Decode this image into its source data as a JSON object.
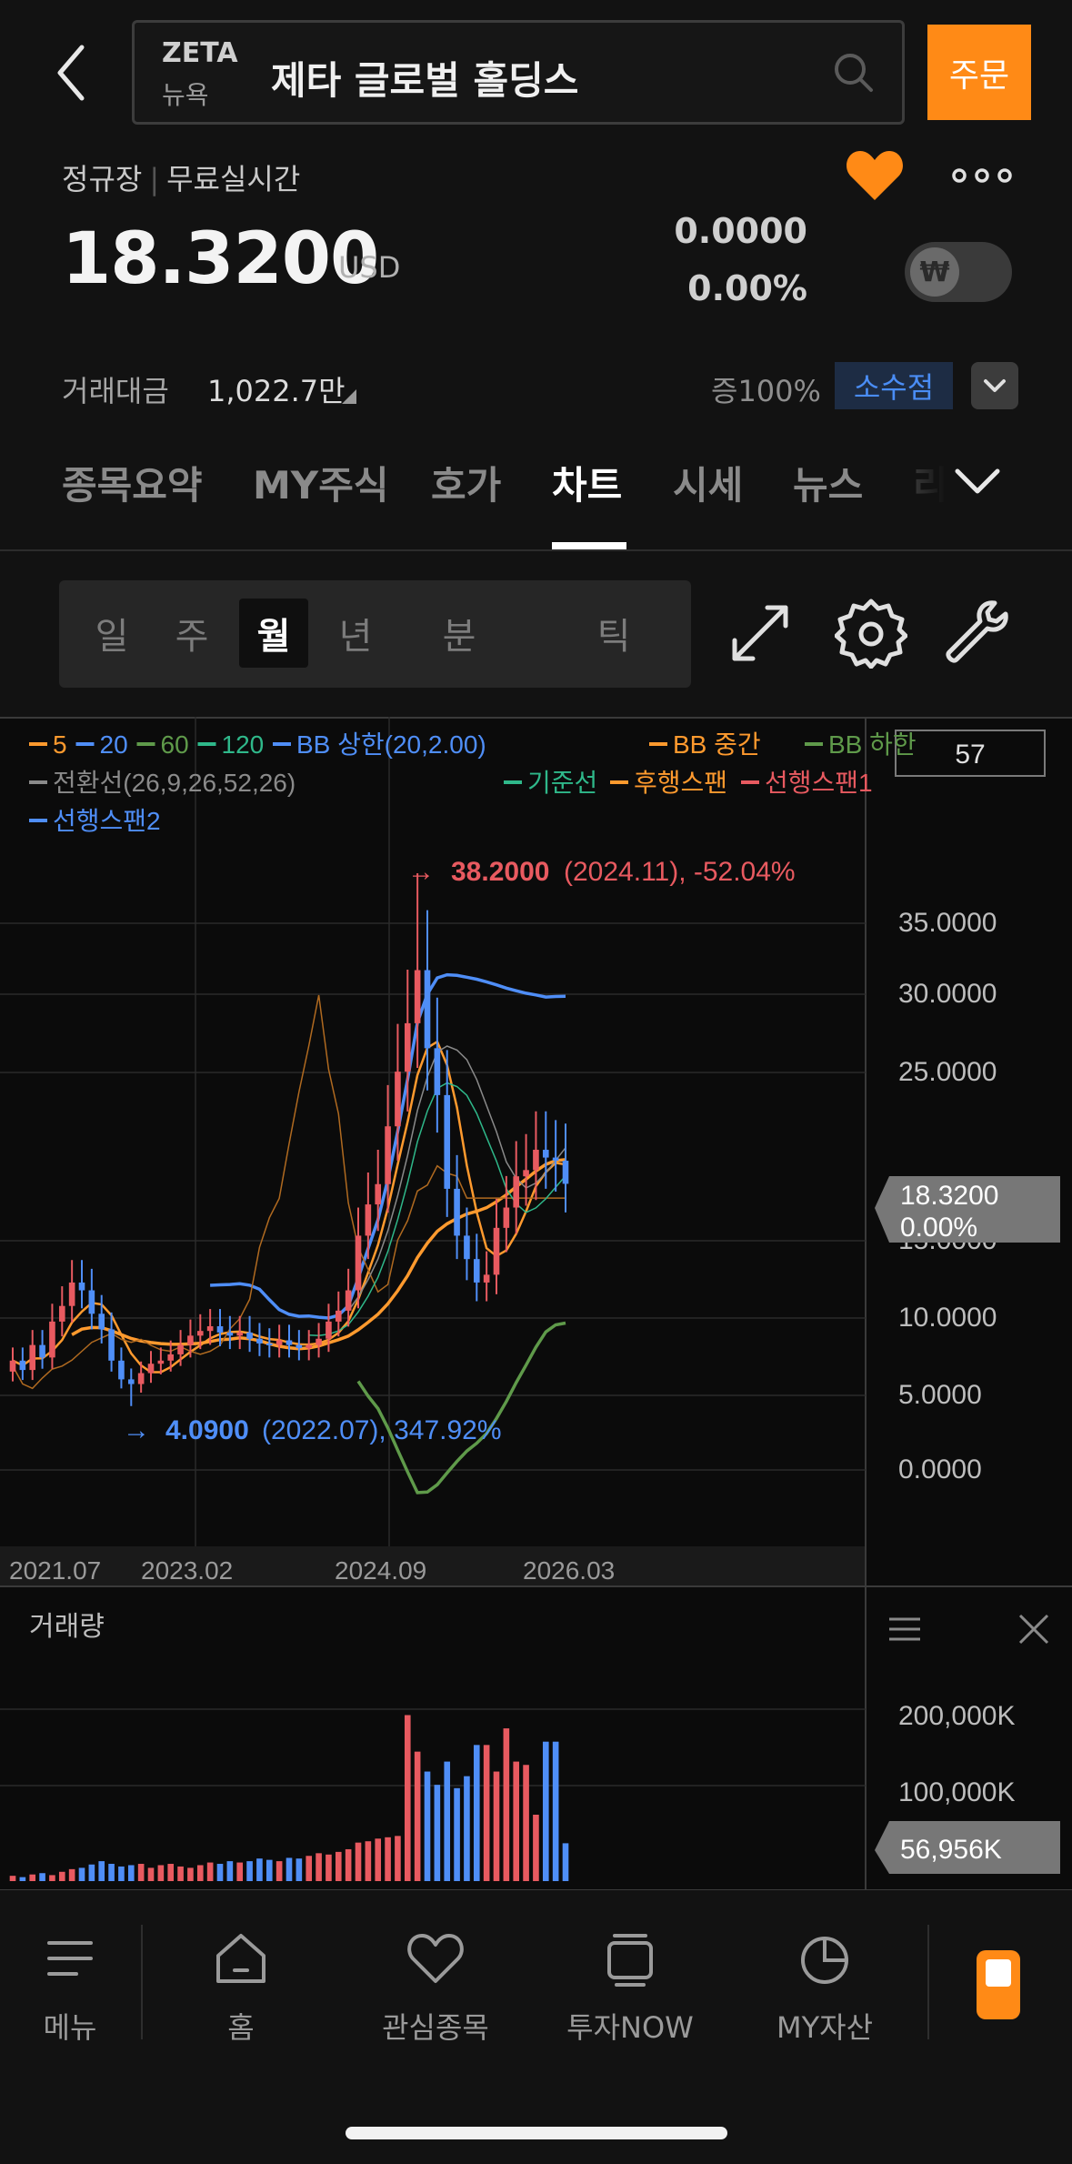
{
  "header": {
    "ticker": "ZETA",
    "exchange": "뉴욕",
    "stock_name": "제타 글로벌 홀딩스",
    "order_label": "주문"
  },
  "quote": {
    "market": "정규장",
    "realtime": "무료실시간",
    "price": "18.3200",
    "currency": "USD",
    "change": "0.0000",
    "change_pct": "0.00%",
    "toggle_symbol": "₩",
    "trade_label": "거래대금",
    "trade_value": "1,022.7만",
    "margin": "증100%",
    "decimal_label": "소수점"
  },
  "tabs": [
    "종목요약",
    "MY주식",
    "호가",
    "차트",
    "시세",
    "뉴스",
    "리"
  ],
  "active_tab": "차트",
  "periods": [
    "일",
    "주",
    "월",
    "년",
    "분",
    "틱"
  ],
  "active_period": "월",
  "chart": {
    "count_box": "57",
    "legend_row1": [
      {
        "label": "5",
        "color": "#ff9a2e"
      },
      {
        "label": "20",
        "color": "#4f8ef7"
      },
      {
        "label": "60",
        "color": "#5f9a4a"
      },
      {
        "label": "120",
        "color": "#2fb88a"
      },
      {
        "label": "BB 상한(20,2.00)",
        "color": "#4f8ef7"
      },
      {
        "label": "BB 중간",
        "color": "#ff9a2e"
      },
      {
        "label": "BB 하한",
        "color": "#5f9a4a"
      }
    ],
    "legend_row2": [
      {
        "label": "전환선(26,9,26,52,26)",
        "color": "#8a8a8a"
      },
      {
        "label": "기준선",
        "color": "#2fb88a"
      },
      {
        "label": "후행스팬",
        "color": "#ff9a2e"
      },
      {
        "label": "선행스팬1",
        "color": "#e85a60"
      }
    ],
    "legend_row3": [
      {
        "label": "선행스팬2",
        "color": "#4f8ef7"
      }
    ],
    "max_annotation": {
      "value": "38.2000",
      "detail": "(2024.11), -52.04%"
    },
    "min_annotation": {
      "value": "4.0900",
      "detail": "(2022.07), 347.92%"
    },
    "y_ticks": [
      "35.0000",
      "30.0000",
      "25.0000",
      "15.0000",
      "10.0000",
      "5.0000",
      "0.0000"
    ],
    "price_tag": {
      "price": "18.3200",
      "pct": "0.00%"
    },
    "x_ticks": [
      "2021.07",
      "2023.02",
      "2024.09",
      "2026.03"
    ],
    "volume_title": "거래량",
    "volume_ticks": [
      "200,000K",
      "100,000K"
    ],
    "volume_tag": "56,956K",
    "up_color": "#e85a60",
    "down_color": "#4f8ef7"
  },
  "chart_data": {
    "type": "candlestick",
    "x_ticks": [
      "2021.07",
      "2023.02",
      "2024.09",
      "2026.03"
    ],
    "ylim": [
      0,
      38.2
    ],
    "last_close": 18.32,
    "max": {
      "value": 38.2,
      "date": "2024.11"
    },
    "min": {
      "value": 4.09,
      "date": "2022.07"
    },
    "closes": [
      7.0,
      6.4,
      8.0,
      7.2,
      9.5,
      10.5,
      12.0,
      11.5,
      10.0,
      9.0,
      7.0,
      5.8,
      5.5,
      6.2,
      6.8,
      7.0,
      7.4,
      8.0,
      8.6,
      8.9,
      9.2,
      8.8,
      8.6,
      8.8,
      8.4,
      8.1,
      8.0,
      8.3,
      8.0,
      7.8,
      8.0,
      8.4,
      9.5,
      10.2,
      11.5,
      15.0,
      17.0,
      18.3,
      22.0,
      25.5,
      28.6,
      32.0,
      27.0,
      24.0,
      18.0,
      15.0,
      13.5,
      12.0,
      12.5,
      15.5,
      16.8,
      18.8,
      19.2,
      20.5,
      20.0,
      19.8,
      18.32
    ],
    "volume": [
      8,
      6,
      10,
      12,
      9,
      14,
      18,
      20,
      25,
      30,
      26,
      22,
      24,
      26,
      20,
      24,
      26,
      22,
      20,
      24,
      28,
      26,
      30,
      28,
      30,
      34,
      32,
      30,
      35,
      34,
      38,
      42,
      40,
      44,
      48,
      58,
      60,
      64,
      66,
      68,
      250,
      195,
      165,
      145,
      180,
      140,
      158,
      205,
      205,
      165,
      230,
      180,
      175,
      100,
      210,
      210,
      57
    ]
  }
}
